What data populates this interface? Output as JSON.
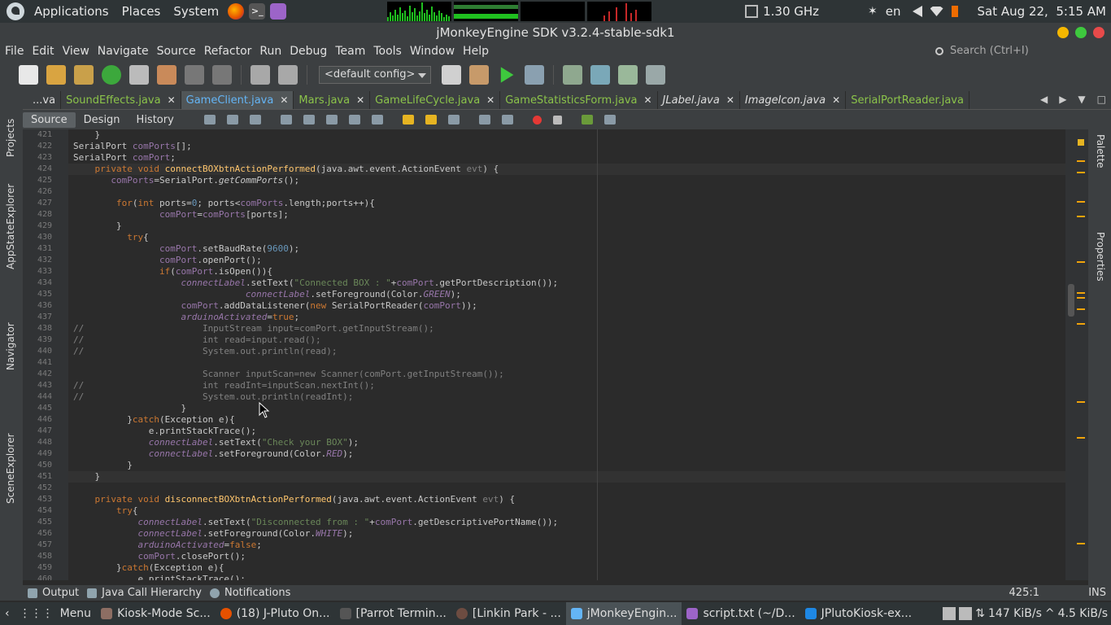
{
  "topbar": {
    "applications": "Applications",
    "places": "Places",
    "system": "System",
    "cpu_freq": "1.30 GHz",
    "lang": "en",
    "datetime": "Sat Aug 22,  5:15 AM"
  },
  "window": {
    "title": "jMonkeyEngine SDK v3.2.4-stable-sdk1"
  },
  "menu": [
    "File",
    "Edit",
    "View",
    "Navigate",
    "Source",
    "Refactor",
    "Run",
    "Debug",
    "Team",
    "Tools",
    "Window",
    "Help"
  ],
  "search": {
    "placeholder": "Search (Ctrl+I)"
  },
  "toolbar": {
    "config": "<default config>"
  },
  "tabs": [
    {
      "label": "...va"
    },
    {
      "label": "SoundEffects.java"
    },
    {
      "label": "GameClient.java"
    },
    {
      "label": "Mars.java"
    },
    {
      "label": "GameLifeCycle.java"
    },
    {
      "label": "GameStatisticsForm.java"
    },
    {
      "label": "JLabel.java"
    },
    {
      "label": "ImageIcon.java"
    },
    {
      "label": "SerialPortReader.java"
    }
  ],
  "editor_tabs": {
    "source": "Source",
    "design": "Design",
    "history": "History"
  },
  "left_panels": {
    "projects": "Projects",
    "appstate": "AppStateExplorer",
    "navigator": "Navigator",
    "scene": "SceneExplorer"
  },
  "right_panels": {
    "palette": "Palette",
    "properties": "Properties"
  },
  "line_numbers": [
    "421",
    "422",
    "423",
    "424",
    "425",
    "426",
    "427",
    "428",
    "429",
    "430",
    "431",
    "432",
    "433",
    "434",
    "435",
    "436",
    "437",
    "438",
    "439",
    "440",
    "441",
    "442",
    "443",
    "444",
    "445",
    "446",
    "447",
    "448",
    "449",
    "450",
    "451",
    "452",
    "453",
    "454",
    "455",
    "456",
    "457",
    "458",
    "459",
    "460"
  ],
  "status": {
    "output": "Output",
    "call_hierarchy": "Java Call Hierarchy",
    "notifications": "Notifications",
    "position": "425:1",
    "mode": "INS"
  },
  "taskbar": {
    "menu": "Menu",
    "items": [
      "Kiosk-Mode Sc...",
      "(18) J-Pluto On...",
      "[Parrot Termin...",
      "[Linkin Park - ...",
      "jMonkeyEngin...",
      "script.txt (~/D...",
      "JPlutoKiosk-ex..."
    ],
    "net_down": "147 KiB/s",
    "net_up": "4.5 KiB/s"
  }
}
